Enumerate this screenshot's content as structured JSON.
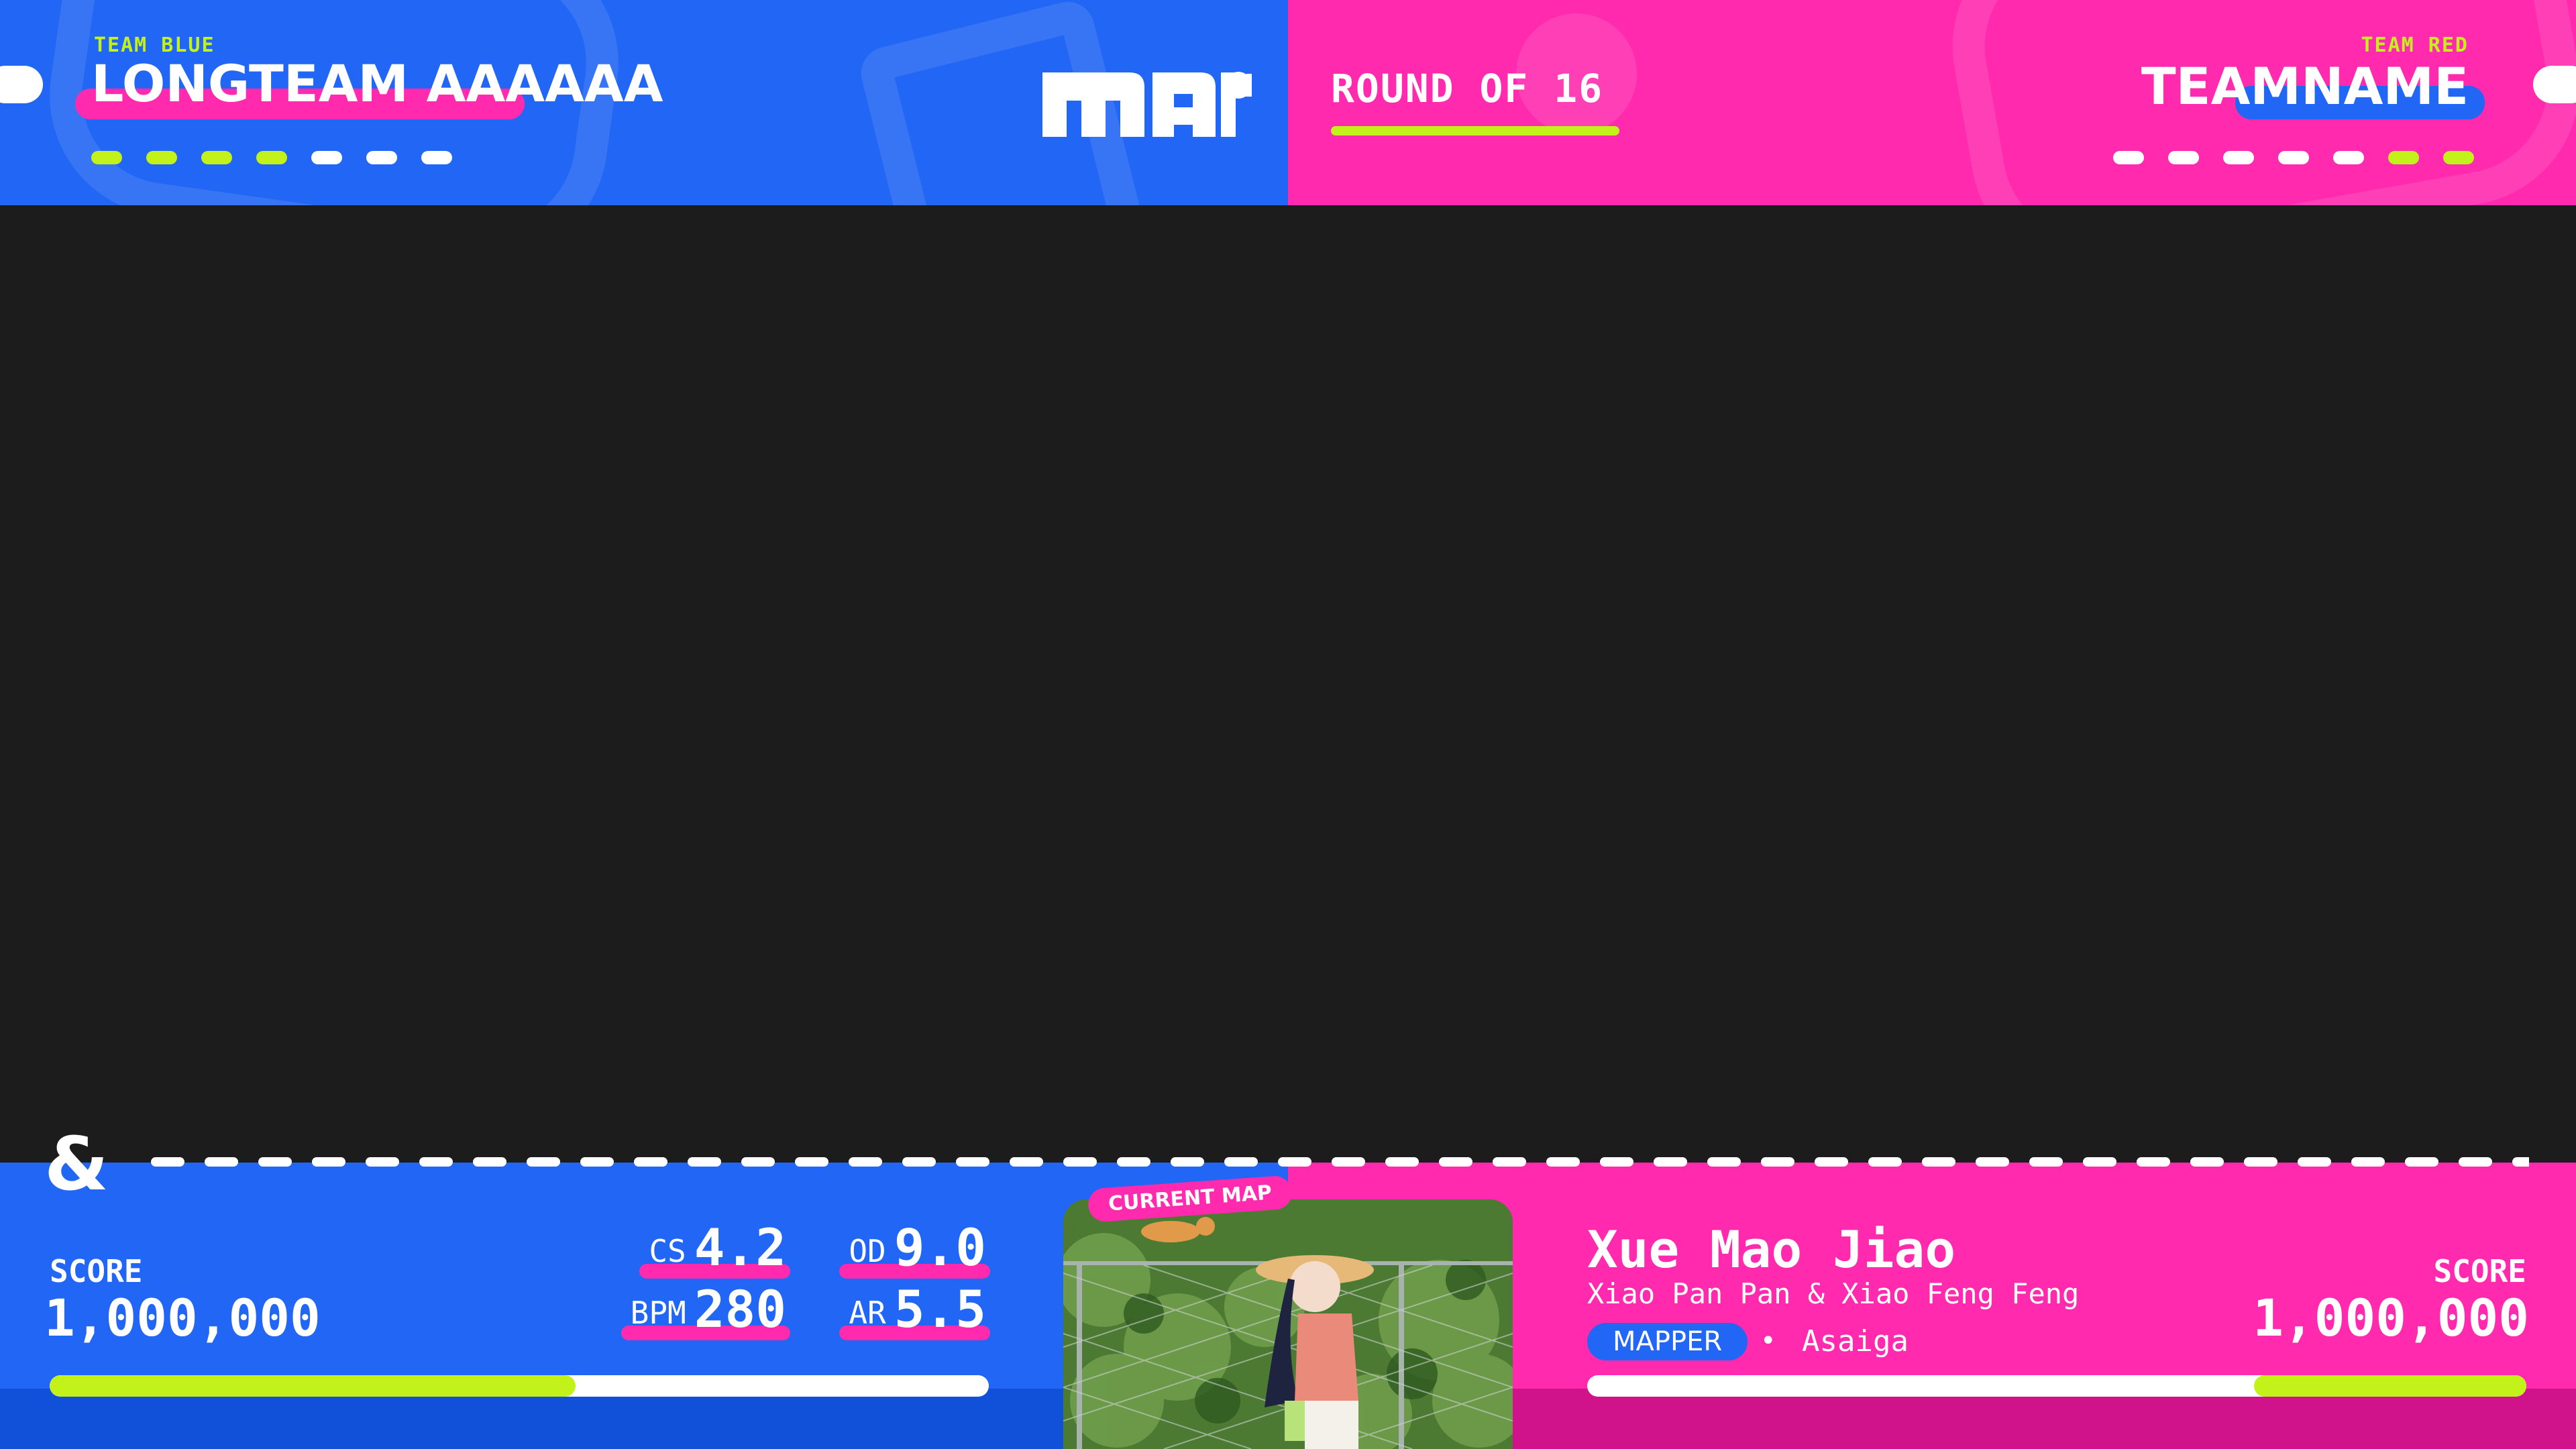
{
  "teams": {
    "blue": {
      "tag": "TEAM BLUE",
      "name": "LONGTEAM AAAAAA",
      "points_won": 4,
      "points_total": 7,
      "score": "1,000,000",
      "progress": 0.56
    },
    "red": {
      "tag": "TEAM RED",
      "name": "TEAMNAME",
      "points_won": 2,
      "points_total": 7,
      "score": "1,000,000",
      "progress": 0.29
    }
  },
  "round": "ROUND OF 16",
  "logo": "mar",
  "score_label": "SCORE",
  "stats": {
    "cs": {
      "label": "CS",
      "value": "4.2"
    },
    "od": {
      "label": "OD",
      "value": "9.0"
    },
    "bpm": {
      "label": "BPM",
      "value": "280"
    },
    "ar": {
      "label": "AR",
      "value": "5.5"
    }
  },
  "current_map": {
    "tag": "CURRENT MAP",
    "title": "Xue Mao Jiao",
    "artist": "Xiao Pan Pan & Xiao Feng Feng",
    "mapper_label": "MAPPER",
    "separator": "•",
    "mapper": "Asaiga"
  },
  "icons": {
    "divider": "ampersand-icon"
  },
  "colors": {
    "blue": "#2166f4",
    "red": "#ff2aad",
    "accent": "#c3f21a",
    "background": "#1c1c1c"
  }
}
